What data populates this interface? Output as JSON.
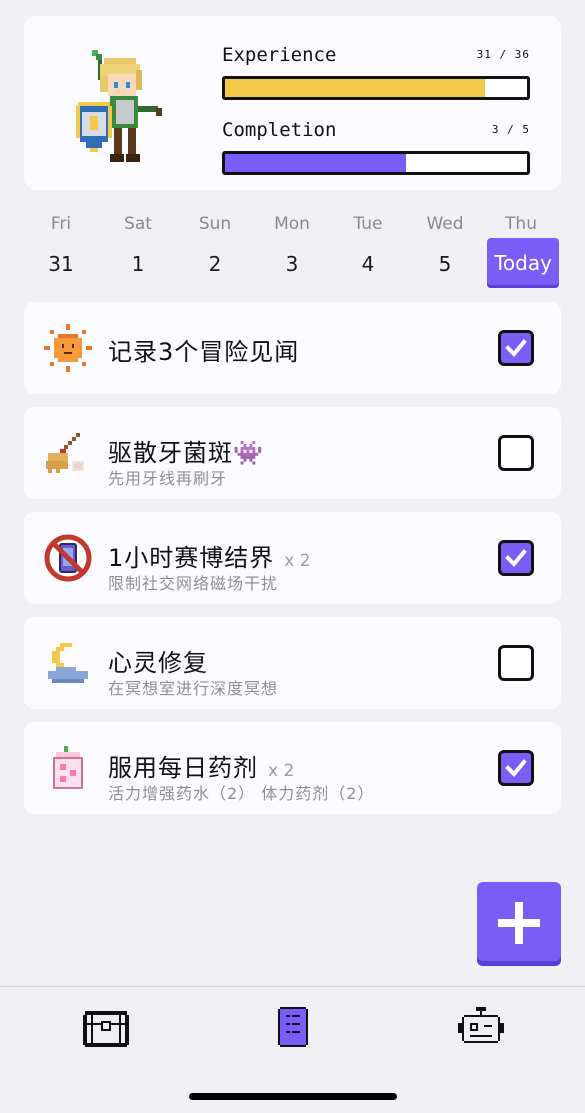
{
  "profile": {
    "experience": {
      "label": "Experience",
      "count": "31 / 36",
      "fraction": 0.861,
      "color": "#f4c94a"
    },
    "completion": {
      "label": "Completion",
      "count": "3 / 5",
      "fraction": 0.6,
      "color": "#7a5cf6"
    }
  },
  "week": [
    {
      "name": "Fri",
      "num": "31"
    },
    {
      "name": "Sat",
      "num": "1"
    },
    {
      "name": "Sun",
      "num": "2"
    },
    {
      "name": "Mon",
      "num": "3"
    },
    {
      "name": "Tue",
      "num": "4"
    },
    {
      "name": "Wed",
      "num": "5"
    },
    {
      "name": "Thu",
      "num": "Today"
    }
  ],
  "tasks": [
    {
      "icon": "sun-icon",
      "title": "记录3个冒险见闻",
      "multiplier": "",
      "subtitle": "",
      "checked": true
    },
    {
      "icon": "broom-icon",
      "title": "驱散牙菌斑👾",
      "multiplier": "",
      "subtitle": "先用牙线再刷牙",
      "checked": false
    },
    {
      "icon": "no-phone-icon",
      "title": "1小时赛博结界",
      "multiplier": "x 2",
      "subtitle": "限制社交网络磁场干扰",
      "checked": true
    },
    {
      "icon": "moon-cloud-icon",
      "title": "心灵修复",
      "multiplier": "",
      "subtitle": "在冥想室进行深度冥想",
      "checked": false
    },
    {
      "icon": "potion-carton-icon",
      "title": "服用每日药剂",
      "multiplier": "x 2",
      "subtitle": "活力增强药水（2） 体力药剂（2）",
      "checked": true
    }
  ],
  "nav": {
    "items": [
      "treasure-chest-icon",
      "scroll-list-icon",
      "robot-icon"
    ],
    "active": "scroll-list-icon"
  },
  "colors": {
    "accent": "#7a5cf6",
    "xp": "#f4c94a"
  }
}
